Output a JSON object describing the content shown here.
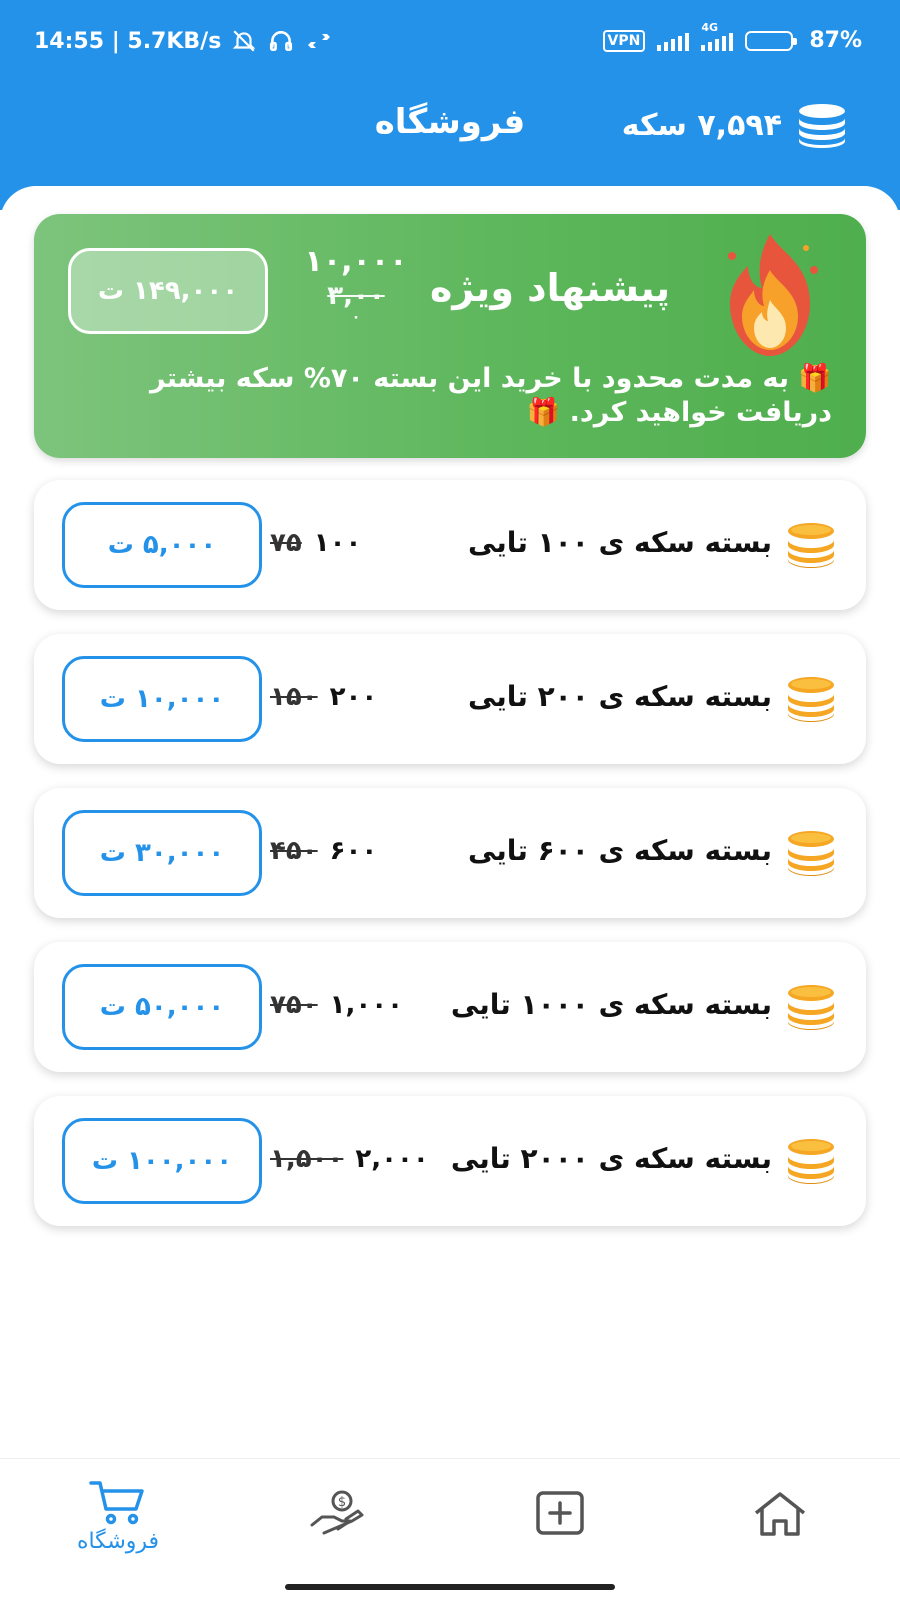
{
  "status_bar": {
    "time_speed": "14:55 | 5.7KB/s",
    "vpn": "VPN",
    "network": "4G",
    "battery": "87%"
  },
  "app_bar": {
    "title": "فروشگاه",
    "coin_balance": "۷,۵۹۴ سکه"
  },
  "special_offer": {
    "title": "پیشنهاد ویژه",
    "amount": "۱۰,۰۰۰",
    "old_amount": "۳,۰۰",
    "old_amount_tail": "۰",
    "price": "۱۴۹,۰۰۰ ت",
    "description": "🎁 به مدت محدود با خرید این بسته ۷۰% سکه بیشتر دریافت خواهید کرد. 🎁"
  },
  "packages": [
    {
      "title": "بسته سکه ی ۱۰۰ تایی",
      "amount": "۱۰۰",
      "old_amount": "۷۵",
      "price": "۵,۰۰۰ ت"
    },
    {
      "title": "بسته سکه ی ۲۰۰ تایی",
      "amount": "۲۰۰",
      "old_amount": "۱۵۰",
      "price": "۱۰,۰۰۰ ت"
    },
    {
      "title": "بسته سکه ی ۶۰۰ تایی",
      "amount": "۶۰۰",
      "old_amount": "۴۵۰",
      "price": "۳۰,۰۰۰ ت"
    },
    {
      "title": "بسته سکه ی ۱۰۰۰ تایی",
      "amount": "۱,۰۰۰",
      "old_amount": "۷۵۰",
      "price": "۵۰,۰۰۰ ت"
    },
    {
      "title": "بسته سکه ی ۲۰۰۰ تایی",
      "amount": "۲,۰۰۰",
      "old_amount": "۱,۵۰۰",
      "price": "۱۰۰,۰۰۰ ت"
    }
  ],
  "bottom_nav": {
    "shop_label": "فروشگاه"
  },
  "colors": {
    "primary": "#2592ea",
    "offer_green": "#5cb65a",
    "coin_orange": "#f5a623"
  }
}
